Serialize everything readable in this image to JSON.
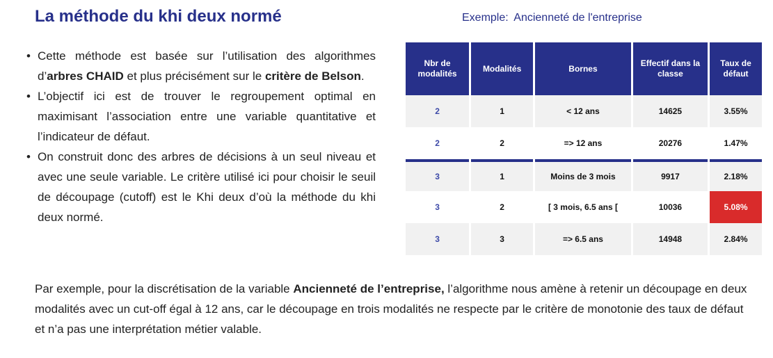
{
  "title": "La méthode du khi deux normé",
  "example": {
    "label": "Exemple:",
    "subject": "Ancienneté de l'entreprise"
  },
  "bullets": [
    {
      "before": "Cette méthode est basée sur l’utilisation des algorithmes d’",
      "bold1": "arbres CHAID",
      "middle": " et plus précisément sur le ",
      "bold2": "critère de Belson",
      "after": "."
    },
    {
      "text": "L’objectif ici est de trouver le regroupement optimal en maximisant l’association entre une variable quantitative et l’indicateur de défaut."
    },
    {
      "text": "On construit donc des arbres de décisions à un seul niveau et avec une seule variable. Le critère utilisé ici pour choisir le seuil de découpage (cutoff) est le Khi deux d’où la méthode du khi deux normé."
    }
  ],
  "table": {
    "headers": [
      "Nbr de modalités",
      "Modalités",
      "Bornes",
      "Effectif dans la classe",
      "Taux de défaut"
    ],
    "rows": [
      [
        "2",
        "1",
        "<  12 ans",
        "14625",
        "3.55%"
      ],
      [
        "2",
        "2",
        "=> 12 ans",
        "20276",
        "1.47%"
      ],
      [
        "3",
        "1",
        "Moins de 3 mois",
        "9917",
        "2.18%"
      ],
      [
        "3",
        "2",
        "[ 3 mois, 6.5 ans [",
        "10036",
        "5.08%"
      ],
      [
        "3",
        "3",
        "=> 6.5 ans",
        "14948",
        "2.84%"
      ]
    ],
    "highlight_color": "#d92b2b"
  },
  "footer": {
    "before": "Par exemple, pour la discrétisation de la variable ",
    "bold": "Ancienneté de l’entreprise,",
    "after": " l’algorithme nous amène à retenir un découpage en deux modalités avec un cut-off égal à 12 ans, car le découpage en trois  modalités ne respecte par le critère de monotonie des taux de défaut et n’a pas une interprétation métier valable."
  },
  "colors": {
    "accent": "#27308a",
    "highlight": "#d92b2b"
  }
}
